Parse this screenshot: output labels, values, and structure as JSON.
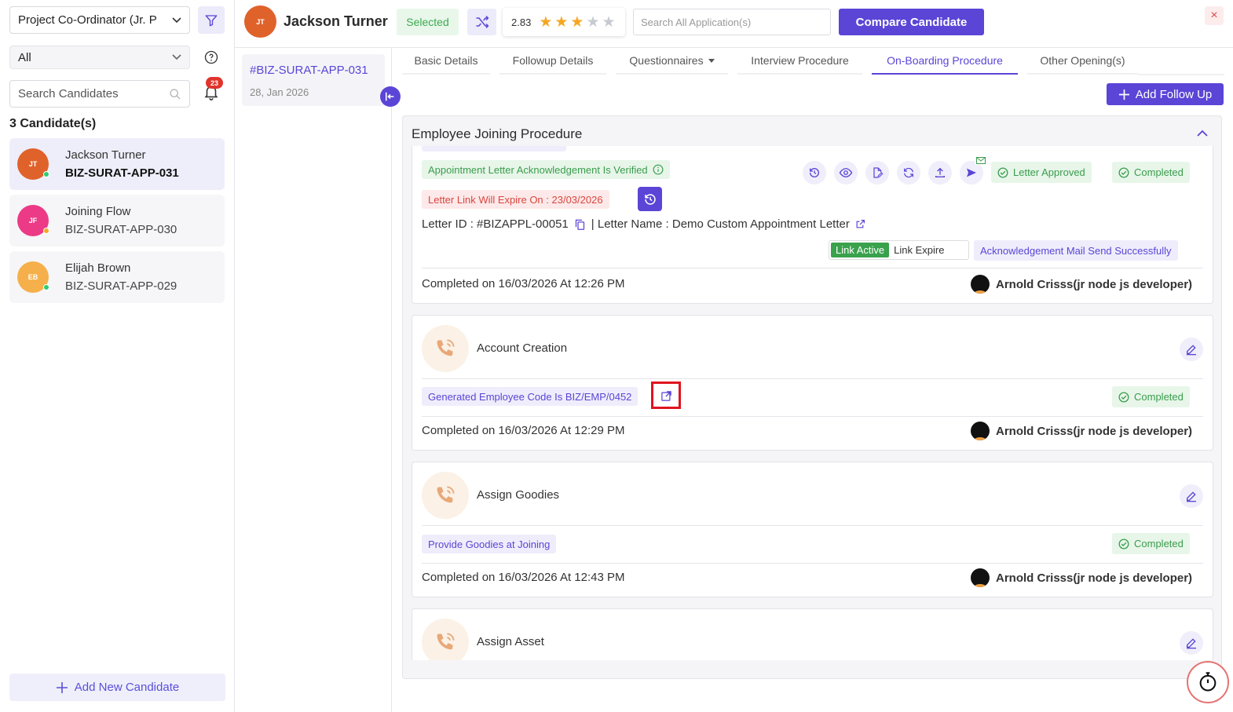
{
  "sidebar": {
    "role_select": "Project Co-Ordinator (Jr. P",
    "status_select": "All",
    "search_placeholder": "Search Candidates",
    "notification_count": "23",
    "count_label": "3 Candidate(s)",
    "candidates": [
      {
        "initials": "JT",
        "name": "Jackson Turner",
        "code": "BIZ-SURAT-APP-031",
        "avatar_color": "#e0622b",
        "dot_color": "#2ecc71"
      },
      {
        "initials": "JF",
        "name": "Joining Flow",
        "code": "BIZ-SURAT-APP-030",
        "avatar_color": "#ec3a86",
        "dot_color": "#f5a623"
      },
      {
        "initials": "EB",
        "name": "Elijah Brown",
        "code": "BIZ-SURAT-APP-029",
        "avatar_color": "#f6b04b",
        "dot_color": "#2ecc71"
      }
    ],
    "add_button": "Add New Candidate"
  },
  "header": {
    "initials": "JT",
    "name": "Jackson Turner",
    "status": "Selected",
    "rating": "2.83",
    "rating_stars": 3,
    "search_placeholder": "Search All Application(s)",
    "compare_button": "Compare Candidate",
    "close_icon": "×"
  },
  "application": {
    "id": "#BIZ-SURAT-APP-031",
    "date": "28, Jan 2026"
  },
  "tabs": [
    {
      "label": "Basic Details"
    },
    {
      "label": "Followup Details"
    },
    {
      "label": "Questionnaires"
    },
    {
      "label": "Interview Procedure"
    },
    {
      "label": "On-Boarding Procedure"
    },
    {
      "label": "Other Opening(s)"
    }
  ],
  "add_follow_up": "Add Follow Up",
  "panel": {
    "title": "Employee Joining Procedure",
    "appointment": {
      "ack_tag": "Appointment Letter Acknowledgement Is Verified",
      "expire_tag": "Letter Link Will Expire On : 23/03/2026",
      "letter_id": "Letter ID : #BIZAPPL-00051",
      "letter_name": "| Letter Name : Demo Custom Appointment Letter",
      "approved_tag": "Letter Approved",
      "completed_tag": "Completed",
      "link_active": "Link Active",
      "link_expire": "Link Expire",
      "mail_tag": "Acknowledgement Mail Send Successfully",
      "completed_on": "Completed on 16/03/2026 At 12:26 PM",
      "user": "Arnold Crisss(jr node js developer)"
    },
    "steps": [
      {
        "title": "Account Creation",
        "tag": "Generated Employee Code Is BIZ/EMP/0452",
        "status": "Completed",
        "completed_on": "Completed on 16/03/2026 At 12:29 PM",
        "user": "Arnold Crisss(jr node js developer)"
      },
      {
        "title": "Assign Goodies",
        "tag": "Provide Goodies at Joining",
        "status": "Completed",
        "completed_on": "Completed on 16/03/2026 At 12:43 PM",
        "user": "Arnold Crisss(jr node js developer)"
      },
      {
        "title": "Assign Asset"
      }
    ]
  },
  "colors": {
    "accent": "#5a45d6",
    "success": "#3b9c4d",
    "danger": "#d9463f",
    "highlight": "#e0141e"
  }
}
